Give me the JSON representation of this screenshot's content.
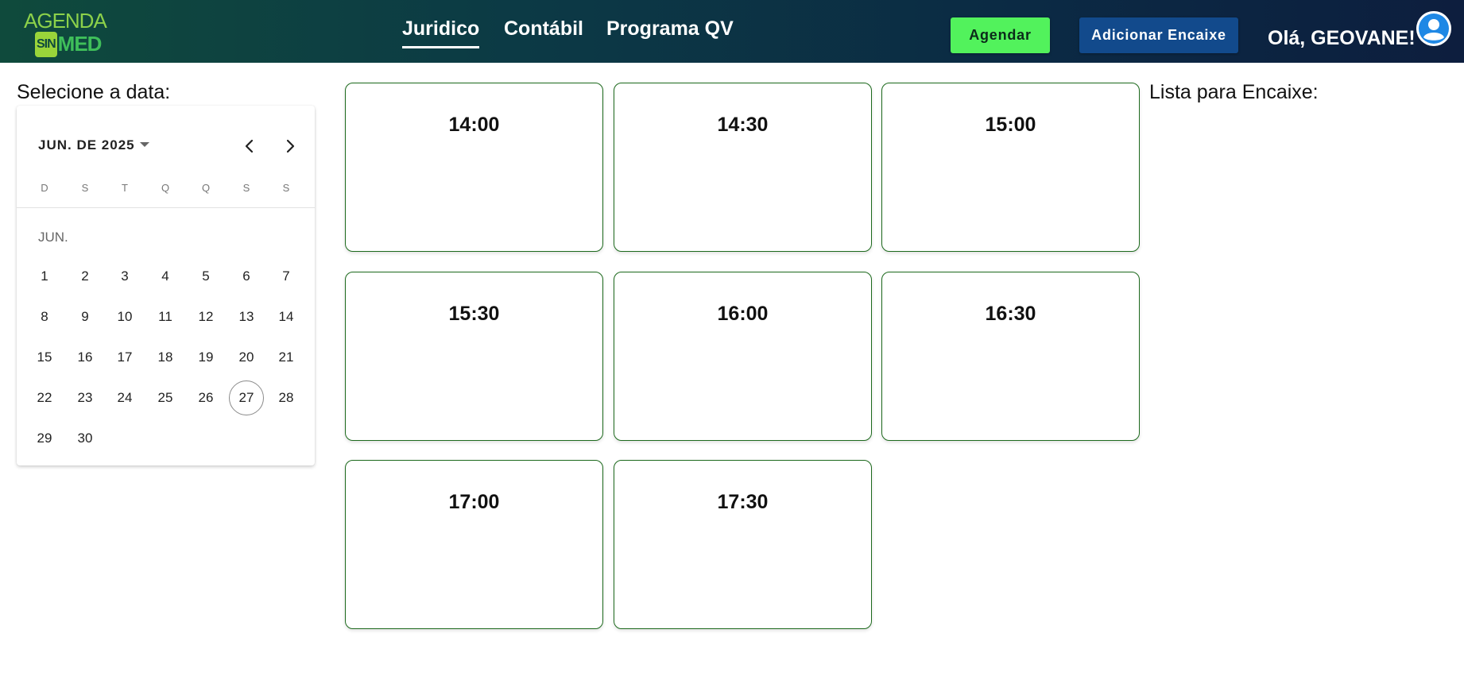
{
  "header": {
    "logo": {
      "line1": "AGENDA",
      "line2_box": "SIN",
      "line2_rest": "MED"
    },
    "nav": [
      {
        "label": "Juridico",
        "active": true
      },
      {
        "label": "Contábil",
        "active": false
      },
      {
        "label": "Programa QV",
        "active": false
      }
    ],
    "agendar_label": "Agendar",
    "adicionar_encaixe_label": "Adicionar Encaixe",
    "greeting": "Olá, GEOVANE!",
    "avatar_icon": "user-avatar-icon"
  },
  "calendar": {
    "label": "Selecione a data:",
    "period_label": "JUN. DE 2025",
    "weekdays": [
      "D",
      "S",
      "T",
      "Q",
      "Q",
      "S",
      "S"
    ],
    "month_label": "JUN.",
    "days": [
      "1",
      "2",
      "3",
      "4",
      "5",
      "6",
      "7",
      "8",
      "9",
      "10",
      "11",
      "12",
      "13",
      "14",
      "15",
      "16",
      "17",
      "18",
      "19",
      "20",
      "21",
      "22",
      "23",
      "24",
      "25",
      "26",
      "27",
      "28",
      "29",
      "30"
    ],
    "first_weekday_index": 0,
    "today": "27",
    "prev_icon": "chevron-left-icon",
    "next_icon": "chevron-right-icon"
  },
  "slots": [
    "14:00",
    "14:30",
    "15:00",
    "15:30",
    "16:00",
    "16:30",
    "17:00",
    "17:30"
  ],
  "encaixe": {
    "label": "Lista para Encaixe:"
  },
  "colors": {
    "agendar": "#52f25c",
    "adicionar_encaixe": "#124a8c",
    "slot_border": "#1d6a1d"
  }
}
